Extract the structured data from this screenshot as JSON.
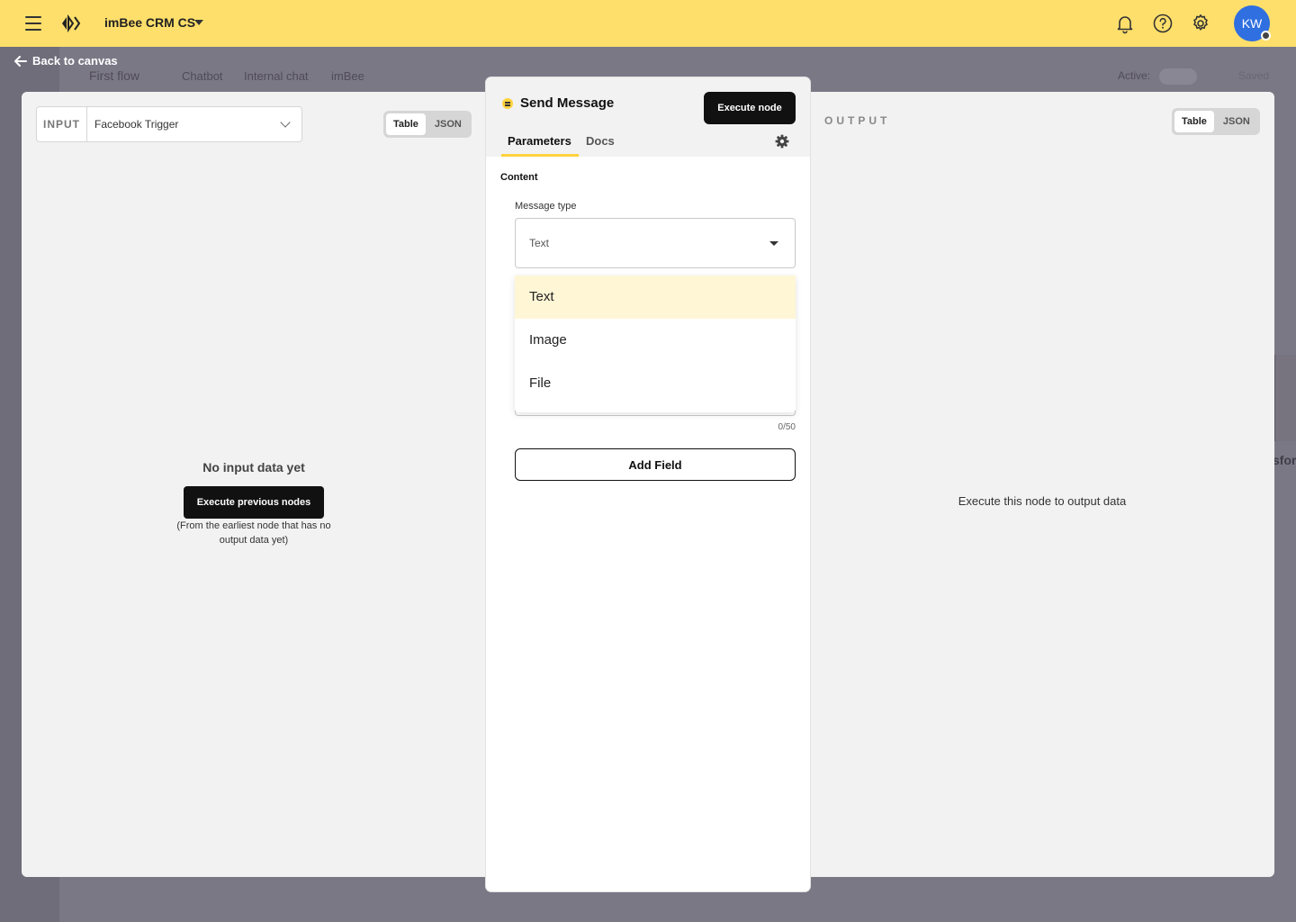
{
  "app": {
    "workspace_name": "imBee CRM CS",
    "avatar_initials": "KW",
    "accent_color": "#ffdf6b"
  },
  "canvas": {
    "back_label": "Back to canvas",
    "flow_name": "First flow",
    "header_tabs": [
      "Chatbot",
      "Internal chat",
      "imBee"
    ],
    "active_label": "Active:",
    "saved_label": "Saved",
    "partial_node_text": "sfor"
  },
  "input": {
    "label": "INPUT",
    "selected_node": "Facebook Trigger",
    "view_toggle": [
      "Table",
      "JSON"
    ],
    "empty_title": "No input data yet",
    "execute_previous_label": "Execute previous nodes",
    "empty_hint": "(From the earliest node that has no output data yet)"
  },
  "node": {
    "title": "Send Message",
    "execute_label": "Execute node",
    "tabs": [
      "Parameters",
      "Docs"
    ],
    "section_label": "Content",
    "message_type_label": "Message type",
    "message_type_value": "Text",
    "message_type_options": [
      "Text",
      "Image",
      "File"
    ],
    "char_counter": "0/50",
    "add_field_label": "Add Field"
  },
  "output": {
    "label": "OUTPUT",
    "view_toggle": [
      "Table",
      "JSON"
    ],
    "empty_message": "Execute this node to output data"
  }
}
